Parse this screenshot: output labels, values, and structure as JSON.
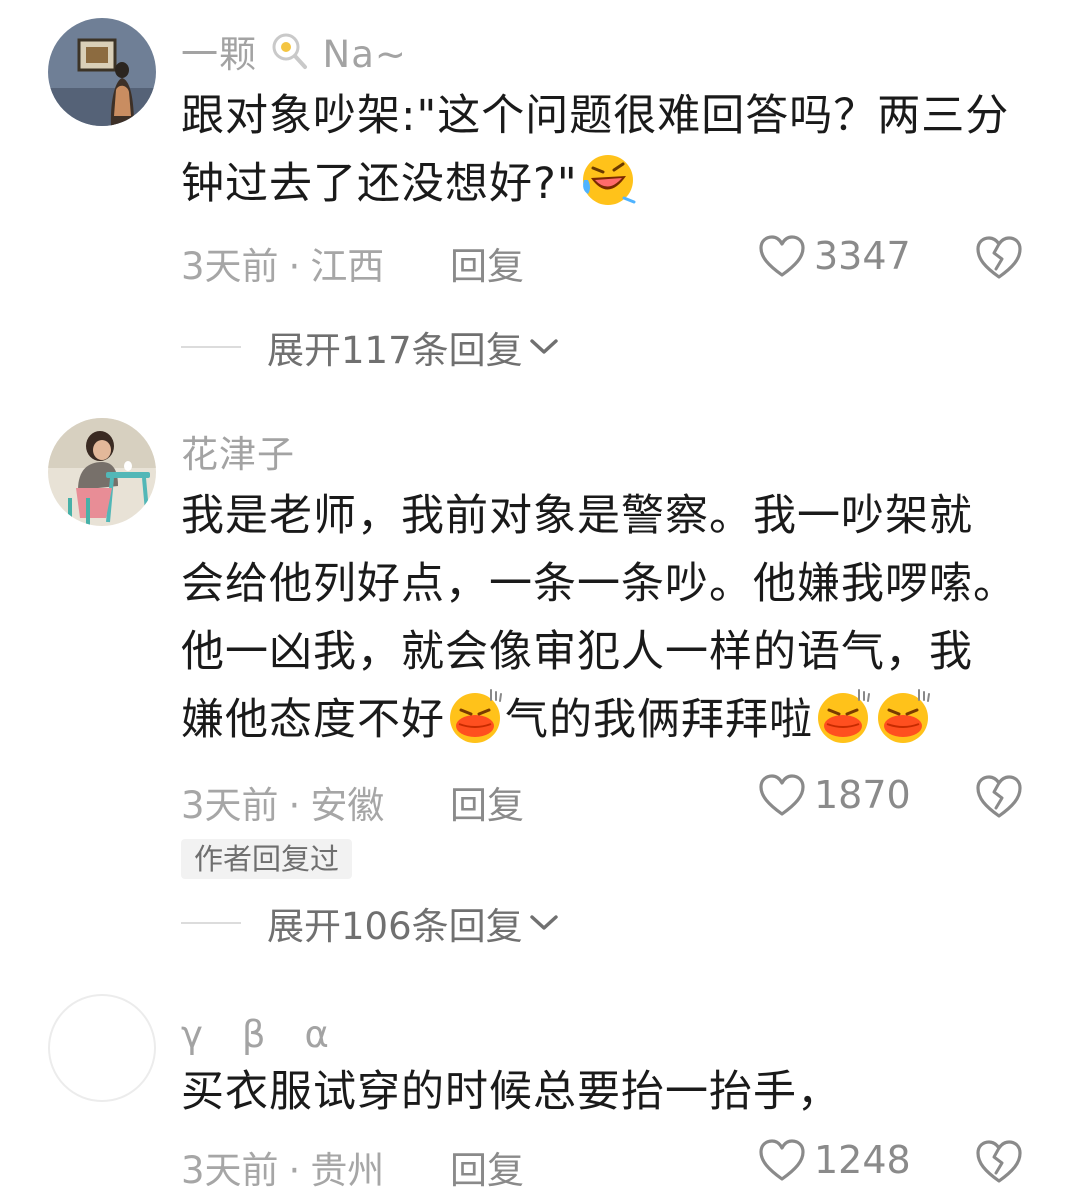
{
  "comments": [
    {
      "username": "一颗",
      "username_suffix": "Na~",
      "username_emoji": "egg-magnifier-emoji",
      "avatar": "gallery-painting-avatar",
      "lines": [
        "跟对象吵架:\"这个问题很难回答吗？两三分",
        "钟过去了还没想好?\""
      ],
      "trailing_emoji": "rofl-emoji",
      "time": "3天前",
      "location": "江西",
      "reply_label": "回复",
      "likes": "3347",
      "expand_label": "展开117条回复"
    },
    {
      "username": "花津子",
      "avatar": "girl-at-table-avatar",
      "lines": [
        "我是老师，我前对象是警察。我一吵架就",
        "会给他列好点，一条一条吵。他嫌我啰嗦。",
        "他一凶我，就会像审犯人一样的语气，我",
        "嫌他态度不好"
      ],
      "line4_mid": "气的我俩拜拜啦",
      "time": "3天前",
      "location": "安徽",
      "reply_label": "回复",
      "likes": "1870",
      "author_badge": "作者回复过",
      "expand_label": "展开106条回复"
    },
    {
      "username": "γ　β　α",
      "avatar": "blank-avatar",
      "lines": [
        "买衣服试穿的时候总要抬一抬手，"
      ],
      "time": "3天前",
      "location": "贵州",
      "reply_label": "回复",
      "likes": "1248"
    }
  ],
  "icons": {
    "like": "heart-outline-icon",
    "dislike": "broken-heart-icon",
    "expand": "chevron-down-icon"
  },
  "colors": {
    "username": "#a3a3a3",
    "body": "#1a1a1a",
    "meta": "#a6a6a6",
    "action": "#8a8a8a"
  }
}
